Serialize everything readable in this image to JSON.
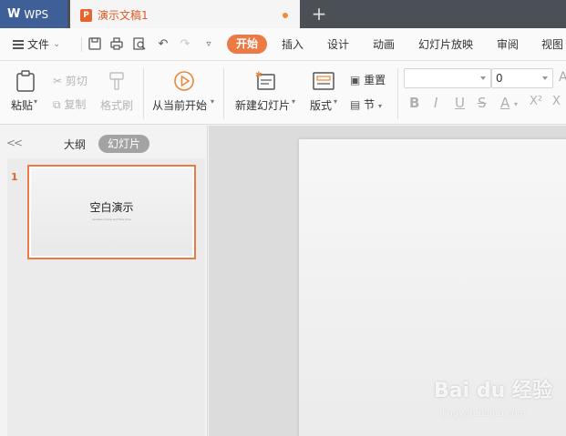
{
  "titlebar": {
    "app_name": "WPS",
    "document_tab": "演示文稿1",
    "new_tab_symbol": "+"
  },
  "menubar": {
    "file": "文件",
    "tabs": [
      "开始",
      "插入",
      "设计",
      "动画",
      "幻灯片放映",
      "审阅",
      "视图"
    ]
  },
  "ribbon": {
    "paste": "粘贴",
    "cut": "剪切",
    "copy": "复制",
    "format_painter": "格式刷",
    "play_from_current": "从当前开始",
    "new_slide": "新建幻灯片",
    "layout": "版式",
    "reset": "重置",
    "section": "节",
    "font_name": "",
    "font_size": "0",
    "format_buttons": [
      "B",
      "I",
      "U",
      "S",
      "A",
      "X²"
    ]
  },
  "left_panel": {
    "tab_outline": "大纲",
    "tab_slides": "幻灯片",
    "slides": [
      {
        "number": "1",
        "title": "空白演示",
        "subtitle": "Speaker name and title here"
      }
    ]
  },
  "watermark": {
    "text": "Bai du 经验",
    "url": "jingyan.baidu.com"
  },
  "colors": {
    "accent": "#ec7a45",
    "title_bar": "#4b4f56",
    "wps_tab": "#3e5f98"
  }
}
